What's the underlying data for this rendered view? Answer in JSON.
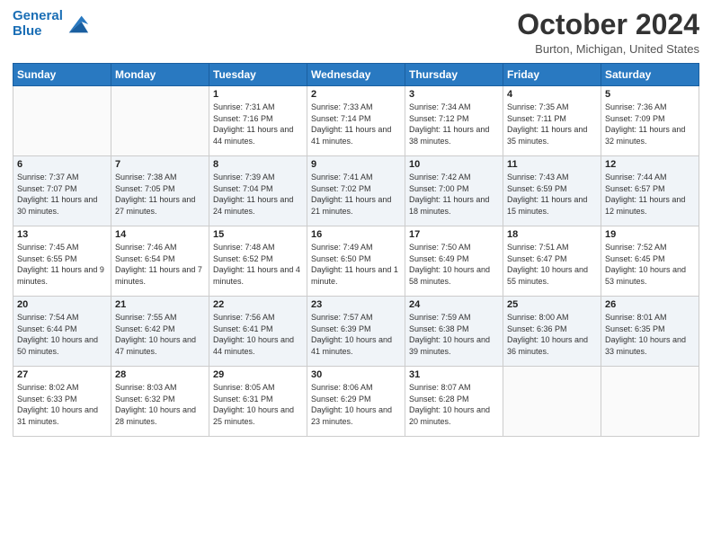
{
  "header": {
    "logo_line1": "General",
    "logo_line2": "Blue",
    "month_title": "October 2024",
    "location": "Burton, Michigan, United States"
  },
  "days_of_week": [
    "Sunday",
    "Monday",
    "Tuesday",
    "Wednesday",
    "Thursday",
    "Friday",
    "Saturday"
  ],
  "weeks": [
    [
      {
        "day": "",
        "info": ""
      },
      {
        "day": "",
        "info": ""
      },
      {
        "day": "1",
        "info": "Sunrise: 7:31 AM\nSunset: 7:16 PM\nDaylight: 11 hours and 44 minutes."
      },
      {
        "day": "2",
        "info": "Sunrise: 7:33 AM\nSunset: 7:14 PM\nDaylight: 11 hours and 41 minutes."
      },
      {
        "day": "3",
        "info": "Sunrise: 7:34 AM\nSunset: 7:12 PM\nDaylight: 11 hours and 38 minutes."
      },
      {
        "day": "4",
        "info": "Sunrise: 7:35 AM\nSunset: 7:11 PM\nDaylight: 11 hours and 35 minutes."
      },
      {
        "day": "5",
        "info": "Sunrise: 7:36 AM\nSunset: 7:09 PM\nDaylight: 11 hours and 32 minutes."
      }
    ],
    [
      {
        "day": "6",
        "info": "Sunrise: 7:37 AM\nSunset: 7:07 PM\nDaylight: 11 hours and 30 minutes."
      },
      {
        "day": "7",
        "info": "Sunrise: 7:38 AM\nSunset: 7:05 PM\nDaylight: 11 hours and 27 minutes."
      },
      {
        "day": "8",
        "info": "Sunrise: 7:39 AM\nSunset: 7:04 PM\nDaylight: 11 hours and 24 minutes."
      },
      {
        "day": "9",
        "info": "Sunrise: 7:41 AM\nSunset: 7:02 PM\nDaylight: 11 hours and 21 minutes."
      },
      {
        "day": "10",
        "info": "Sunrise: 7:42 AM\nSunset: 7:00 PM\nDaylight: 11 hours and 18 minutes."
      },
      {
        "day": "11",
        "info": "Sunrise: 7:43 AM\nSunset: 6:59 PM\nDaylight: 11 hours and 15 minutes."
      },
      {
        "day": "12",
        "info": "Sunrise: 7:44 AM\nSunset: 6:57 PM\nDaylight: 11 hours and 12 minutes."
      }
    ],
    [
      {
        "day": "13",
        "info": "Sunrise: 7:45 AM\nSunset: 6:55 PM\nDaylight: 11 hours and 9 minutes."
      },
      {
        "day": "14",
        "info": "Sunrise: 7:46 AM\nSunset: 6:54 PM\nDaylight: 11 hours and 7 minutes."
      },
      {
        "day": "15",
        "info": "Sunrise: 7:48 AM\nSunset: 6:52 PM\nDaylight: 11 hours and 4 minutes."
      },
      {
        "day": "16",
        "info": "Sunrise: 7:49 AM\nSunset: 6:50 PM\nDaylight: 11 hours and 1 minute."
      },
      {
        "day": "17",
        "info": "Sunrise: 7:50 AM\nSunset: 6:49 PM\nDaylight: 10 hours and 58 minutes."
      },
      {
        "day": "18",
        "info": "Sunrise: 7:51 AM\nSunset: 6:47 PM\nDaylight: 10 hours and 55 minutes."
      },
      {
        "day": "19",
        "info": "Sunrise: 7:52 AM\nSunset: 6:45 PM\nDaylight: 10 hours and 53 minutes."
      }
    ],
    [
      {
        "day": "20",
        "info": "Sunrise: 7:54 AM\nSunset: 6:44 PM\nDaylight: 10 hours and 50 minutes."
      },
      {
        "day": "21",
        "info": "Sunrise: 7:55 AM\nSunset: 6:42 PM\nDaylight: 10 hours and 47 minutes."
      },
      {
        "day": "22",
        "info": "Sunrise: 7:56 AM\nSunset: 6:41 PM\nDaylight: 10 hours and 44 minutes."
      },
      {
        "day": "23",
        "info": "Sunrise: 7:57 AM\nSunset: 6:39 PM\nDaylight: 10 hours and 41 minutes."
      },
      {
        "day": "24",
        "info": "Sunrise: 7:59 AM\nSunset: 6:38 PM\nDaylight: 10 hours and 39 minutes."
      },
      {
        "day": "25",
        "info": "Sunrise: 8:00 AM\nSunset: 6:36 PM\nDaylight: 10 hours and 36 minutes."
      },
      {
        "day": "26",
        "info": "Sunrise: 8:01 AM\nSunset: 6:35 PM\nDaylight: 10 hours and 33 minutes."
      }
    ],
    [
      {
        "day": "27",
        "info": "Sunrise: 8:02 AM\nSunset: 6:33 PM\nDaylight: 10 hours and 31 minutes."
      },
      {
        "day": "28",
        "info": "Sunrise: 8:03 AM\nSunset: 6:32 PM\nDaylight: 10 hours and 28 minutes."
      },
      {
        "day": "29",
        "info": "Sunrise: 8:05 AM\nSunset: 6:31 PM\nDaylight: 10 hours and 25 minutes."
      },
      {
        "day": "30",
        "info": "Sunrise: 8:06 AM\nSunset: 6:29 PM\nDaylight: 10 hours and 23 minutes."
      },
      {
        "day": "31",
        "info": "Sunrise: 8:07 AM\nSunset: 6:28 PM\nDaylight: 10 hours and 20 minutes."
      },
      {
        "day": "",
        "info": ""
      },
      {
        "day": "",
        "info": ""
      }
    ]
  ]
}
